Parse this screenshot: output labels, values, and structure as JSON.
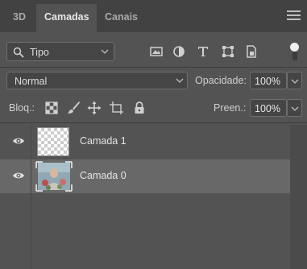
{
  "tabs": [
    "3D",
    "Camadas",
    "Canais"
  ],
  "active_tab": "Camadas",
  "filter": {
    "kind_label": "Tipo",
    "icons": [
      "image-filter-icon",
      "adjustment-filter-icon",
      "type-filter-icon",
      "shape-filter-icon",
      "smart-object-filter-icon"
    ],
    "toggle": "filter-toggle"
  },
  "blend": {
    "mode": "Normal",
    "opacity_label": "Opacidade:",
    "opacity_value": "100%"
  },
  "lock": {
    "label": "Bloq.:",
    "icons": [
      "lock-transparent-pixels-icon",
      "lock-image-pixels-icon",
      "lock-position-icon",
      "lock-artboard-icon",
      "lock-all-icon"
    ],
    "fill_label": "Preen.:",
    "fill_value": "100%"
  },
  "layers": [
    {
      "name": "Camada 1",
      "visible": true,
      "selected": false,
      "thumbnail": "transparent"
    },
    {
      "name": "Camada 0",
      "visible": true,
      "selected": true,
      "thumbnail": "image"
    }
  ],
  "colors": {
    "panel_bg": "#535353",
    "tabbar_bg": "#424242",
    "selected_row": "#686868",
    "text": "#d6d6d6"
  }
}
